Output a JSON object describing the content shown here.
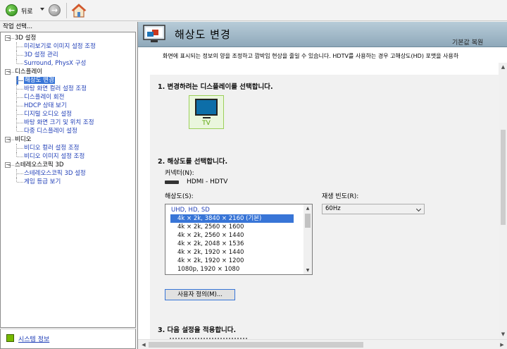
{
  "toolbar": {
    "back_label": "뒤로",
    "icons": [
      "back-arrow-icon",
      "forward-arrow-icon",
      "home-icon"
    ]
  },
  "left": {
    "header": "작업 선택...",
    "tree": [
      {
        "label": "3D 설정",
        "children": [
          "미리보기로 이미지 설정 조정",
          "3D 설정 관리",
          "Surround, PhysX 구성"
        ]
      },
      {
        "label": "디스플레이",
        "children": [
          "해상도 변경",
          "바탕 화면 컬러 설정 조정",
          "디스플레이 회전",
          "HDCP 상태 보기",
          "디지털 오디오 설정",
          "바탕 화면 크기 및 위치 조정",
          "다중 디스플레이 설정"
        ]
      },
      {
        "label": "비디오",
        "children": [
          "비디오 컬러 설정 조정",
          "비디오 이미지 설정 조정"
        ]
      },
      {
        "label": "스테레오스코픽 3D",
        "children": [
          "스테레오스코픽 3D 설정",
          "게임 등급 보기"
        ]
      }
    ],
    "selected": "해상도 변경",
    "footer_link": "시스템 정보"
  },
  "main": {
    "title": "해상도 변경",
    "restore_link": "기본값 복원",
    "description": "화면에 표시되는 정보의 양을 조정하고 깜박임 현상을 줄일 수 있습니다. HDTV를 사용하는 경우 고해상도(HD) 포맷을 사용하",
    "section1": "1. 변경하려는 디스플레이를 선택합니다.",
    "display_name": "TV",
    "section2": "2. 해상도를 선택합니다.",
    "connector_label": "커넥터(N):",
    "connector_value": "HDMI - HDTV",
    "resolution_label": "해상도(S):",
    "resolution_group": "UHD, HD, SD",
    "resolutions": [
      "4k × 2k, 3840 × 2160 (기본)",
      "4k × 2k, 2560 × 1600",
      "4k × 2k, 2560 × 1440",
      "4k × 2k, 2048 × 1536",
      "4k × 2k, 1920 × 1440",
      "4k × 2k, 1920 × 1200",
      "1080p, 1920 × 1080"
    ],
    "selected_resolution": "4k × 2k, 3840 × 2160 (기본)",
    "refresh_label": "재생 빈도(R):",
    "refresh_value": "60Hz",
    "custom_button": "사용자 정의(M)...",
    "section3": "3. 다음 설정을 적용합니다."
  },
  "colors": {
    "accent_nvidia": "#76b900",
    "selection": "#3875d7",
    "link": "#1f3eb7",
    "banner": "#9fb7c6"
  }
}
